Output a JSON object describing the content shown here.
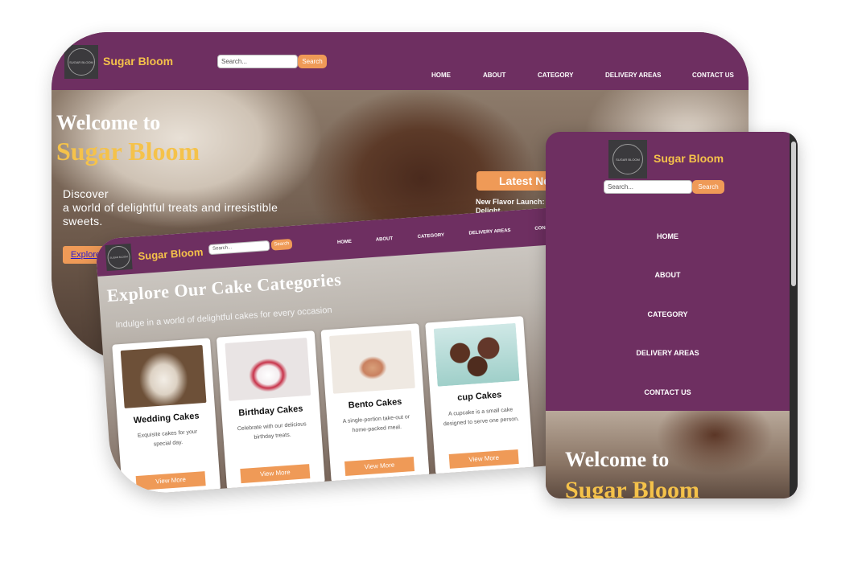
{
  "brand": "Sugar Bloom",
  "logo_text": "SUGAR BLOOM",
  "search": {
    "placeholder": "Search...",
    "button": "Search"
  },
  "nav": [
    "HOME",
    "ABOUT",
    "CATEGORY",
    "DELIVERY AREAS",
    "CONTACT US"
  ],
  "nav_short": [
    "HOME",
    "ABOUT",
    "CATEGORY",
    "DELIVERY AREAS",
    "CON"
  ],
  "hero": {
    "line1": "Welcome to",
    "line2": "Sugar Bloom",
    "desc_line1": "Discover",
    "desc_line2": "a world of delightful treats and irresistible",
    "desc_line3": "sweets.",
    "cta": "Explore Now",
    "latest": "Latest Ne",
    "flavor_line1": "New Flavor Launch:",
    "flavor_line2": "Delight"
  },
  "categories": {
    "title": "Explore Our Cake Categories",
    "subtitle": "Indulge in a world of delightful cakes for every occasion",
    "cards": [
      {
        "title": "Wedding Cakes",
        "desc": "Exquisite cakes for your special day.",
        "button": "View More"
      },
      {
        "title": "Birthday Cakes",
        "desc": "Celebrate with our delicious birthday treats.",
        "button": "View More"
      },
      {
        "title": "Bento Cakes",
        "desc": "A single-portion take-out or home-packed meal.",
        "button": "View More"
      },
      {
        "title": "cup Cakes",
        "desc": "A cupcake is a small cake designed to serve one person.",
        "button": "View More"
      }
    ]
  },
  "colors": {
    "nav": "#6e2f61",
    "accent": "#ef9a57",
    "gold": "#f5c24a"
  }
}
